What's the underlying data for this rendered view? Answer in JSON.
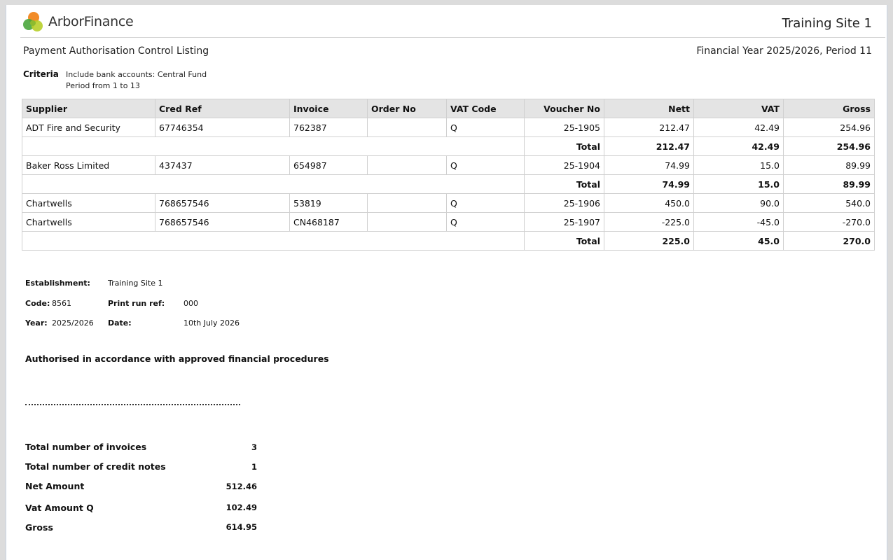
{
  "header": {
    "brand": "ArborFinance",
    "site": "Training Site 1",
    "report_title": "Payment Authorisation Control Listing",
    "period": "Financial Year 2025/2026, Period 11"
  },
  "criteria": {
    "label": "Criteria",
    "lines": [
      "Include bank accounts: Central Fund",
      "Period from 1 to 13"
    ]
  },
  "table": {
    "columns": [
      "Supplier",
      "Cred Ref",
      "Invoice",
      "Order No",
      "VAT Code",
      "Voucher No",
      "Nett",
      "VAT",
      "Gross"
    ],
    "total_label": "Total",
    "rows": [
      {
        "supplier": "ADT Fire and Security",
        "cred_ref": "67746354",
        "invoice": "762387",
        "order_no": "",
        "vat_code": "Q",
        "voucher": "25-1905",
        "nett": "212.47",
        "vat": "42.49",
        "gross": "254.96"
      },
      {
        "total": true,
        "nett": "212.47",
        "vat": "42.49",
        "gross": "254.96"
      },
      {
        "supplier": "Baker Ross Limited",
        "cred_ref": "437437",
        "invoice": "654987",
        "order_no": "",
        "vat_code": "Q",
        "voucher": "25-1904",
        "nett": "74.99",
        "vat": "15.0",
        "gross": "89.99"
      },
      {
        "total": true,
        "nett": "74.99",
        "vat": "15.0",
        "gross": "89.99"
      },
      {
        "supplier": "Chartwells",
        "cred_ref": "768657546",
        "invoice": "53819",
        "order_no": "",
        "vat_code": "Q",
        "voucher": "25-1906",
        "nett": "450.0",
        "vat": "90.0",
        "gross": "540.0"
      },
      {
        "supplier": "Chartwells",
        "cred_ref": "768657546",
        "invoice": "CN468187",
        "order_no": "",
        "vat_code": "Q",
        "voucher": "25-1907",
        "nett": "-225.0",
        "vat": "-45.0",
        "gross": "-270.0"
      },
      {
        "total": true,
        "nett": "225.0",
        "vat": "45.0",
        "gross": "270.0"
      }
    ]
  },
  "establishment": {
    "establishment_label": "Establishment:",
    "establishment_value": "Training Site 1",
    "code_label": "Code:",
    "code_value": "8561",
    "print_run_label": "Print run ref:",
    "print_run_value": "000",
    "year_label": "Year:",
    "year_value": "2025/2026",
    "date_label": "Date:",
    "date_value": "10th July 2026"
  },
  "authorisation": {
    "statement": "Authorised in accordance with approved financial procedures"
  },
  "summary": [
    {
      "label": "Total number of invoices",
      "value": "3"
    },
    {
      "label": "Total number of credit notes",
      "value": "1"
    },
    {
      "label": "Net Amount",
      "value": "512.46"
    },
    {
      "label": "Vat Amount Q",
      "value": "102.49"
    },
    {
      "label": "Gross",
      "value": "614.95"
    }
  ],
  "colors": {
    "logo_orange": "#f28c28",
    "logo_green": "#4aa63c",
    "logo_lime": "#b7cf2a",
    "header_row_bg": "#e4e4e4"
  }
}
